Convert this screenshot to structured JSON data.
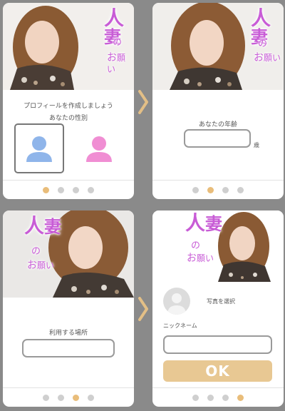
{
  "brand": {
    "line1": "人",
    "line2": "妻",
    "line3": "の",
    "line4": "お",
    "line5": "願",
    "line6": "い"
  },
  "step1": {
    "title": "プロフィールを作成しましょう",
    "label": "あなたの性別",
    "gender_options": [
      "male",
      "female"
    ],
    "selected_gender": "male"
  },
  "step2": {
    "label": "あなたの年齢",
    "suffix": "歳",
    "value": ""
  },
  "step3": {
    "label": "利用する場所",
    "value": ""
  },
  "step4": {
    "photo_label": "写真を選択",
    "nickname_label": "ニックネーム",
    "nickname_value": "",
    "ok_label": "OK"
  },
  "pagination": {
    "total": 4,
    "active_steps": [
      1,
      2,
      3,
      4
    ]
  },
  "colors": {
    "accent": "#e9bd7a",
    "male": "#8fb5ea",
    "female": "#f08ed3",
    "brand": "#c85cd6",
    "ok_button": "#e8c893",
    "background": "#8a8a8a"
  },
  "icons": [
    "male-user-icon",
    "female-user-icon",
    "avatar-placeholder-icon",
    "chevron-right-icon"
  ]
}
